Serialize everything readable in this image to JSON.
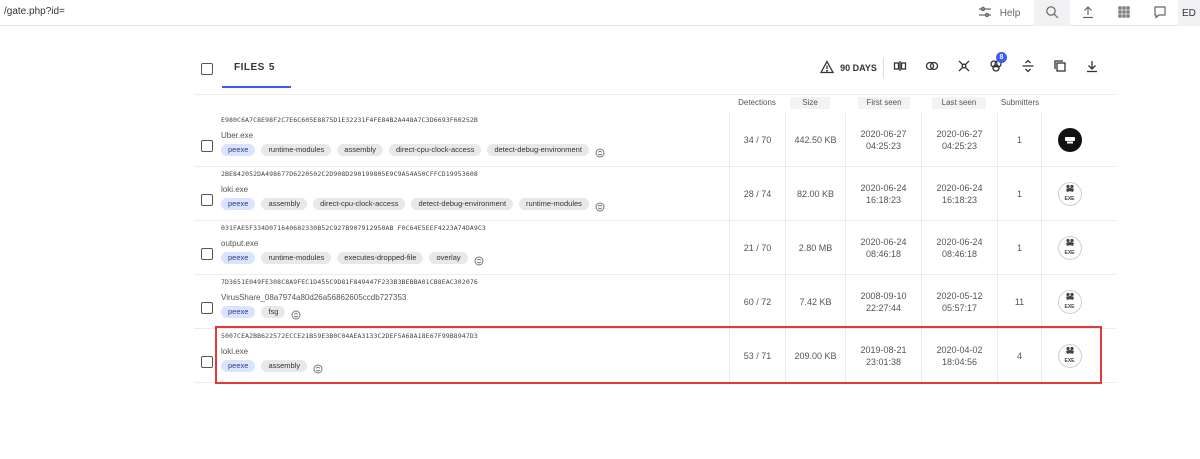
{
  "topbar": {
    "search_text": "/gate.php?id=",
    "help_label": "Help",
    "user_initials": "ED",
    "icons": [
      "filter-icon",
      "search-icon",
      "upload-icon",
      "apps-grid-icon",
      "chat-icon"
    ]
  },
  "panel": {
    "files_tab_label": "FILES",
    "files_count": "5",
    "days_label": "90 DAYS",
    "badge_count": "8"
  },
  "columns": {
    "detections": "Detections",
    "size": "Size",
    "first_seen": "First seen",
    "last_seen": "Last seen",
    "submitters": "Submitters"
  },
  "rows": [
    {
      "hash": "E980C6A7C8E98F2C7E6C605E8875D1E32231F4FE84B2A448A7C3D6693F60252B",
      "name": "Uber.exe",
      "tags": [
        "peexe",
        "runtime-modules",
        "assembly",
        "direct-cpu-clock-access",
        "detect-debug-environment"
      ],
      "detections": "34 / 70",
      "size": "442.50 KB",
      "first_date": "2020-06-27",
      "first_time": "04:25:23",
      "last_date": "2020-06-27",
      "last_time": "04:25:23",
      "submitters": "1",
      "file_icon": "custom-dark-icon"
    },
    {
      "hash": "2BE842052DA498677D6220502C2D908D290199805E9C9A54A50CFFCD19953608",
      "name": "loki.exe",
      "tags": [
        "peexe",
        "assembly",
        "direct-cpu-clock-access",
        "detect-debug-environment",
        "runtime-modules"
      ],
      "detections": "28 / 74",
      "size": "82.00 KB",
      "first_date": "2020-06-24",
      "first_time": "16:18:23",
      "last_date": "2020-06-24",
      "last_time": "16:18:23",
      "submitters": "1",
      "file_icon": "exe-icon",
      "file_icon_label": "EXE"
    },
    {
      "hash": "031FAE5F334D071640682330B52C927B907912950AB F0C64E5EEF4223A74DA9C3",
      "name": "output.exe",
      "tags": [
        "peexe",
        "runtime-modules",
        "executes-dropped-file",
        "overlay"
      ],
      "detections": "21 / 70",
      "size": "2.80 MB",
      "first_date": "2020-06-24",
      "first_time": "08:46:18",
      "last_date": "2020-06-24",
      "last_time": "08:46:18",
      "submitters": "1",
      "file_icon": "exe-icon",
      "file_icon_label": "EXE"
    },
    {
      "hash": "7D3651E049FE308C8A9FEC1D455C9D81F849447F233B3BEBBA01CB8EAC302076",
      "name": "VirusShare_08a7974a80d26a56862605ccdb727353",
      "tags": [
        "peexe",
        "fsg"
      ],
      "detections": "60 / 72",
      "size": "7.42 KB",
      "first_date": "2008-09-10",
      "first_time": "22:27:44",
      "last_date": "2020-05-12",
      "last_time": "05:57:17",
      "submitters": "11",
      "file_icon": "exe-icon",
      "file_icon_label": "EXE"
    },
    {
      "hash": "5007CEA2BB622572ECCE21B59E3B0C04AEA3133C2DEF5A68A18E67F99B8947D3",
      "name": "loki.exe",
      "tags": [
        "peexe",
        "assembly"
      ],
      "detections": "53 / 71",
      "size": "209.00 KB",
      "first_date": "2019-08-21",
      "first_time": "23:01:38",
      "last_date": "2020-04-02",
      "last_time": "18:04:56",
      "submitters": "4",
      "file_icon": "exe-icon",
      "file_icon_label": "EXE",
      "highlighted": true
    }
  ],
  "colors": {
    "accent": "#3d5afe",
    "highlight": "#e53935",
    "tag_blue_bg": "#dbe4ff",
    "tag_grey_bg": "#e8e8ea"
  }
}
